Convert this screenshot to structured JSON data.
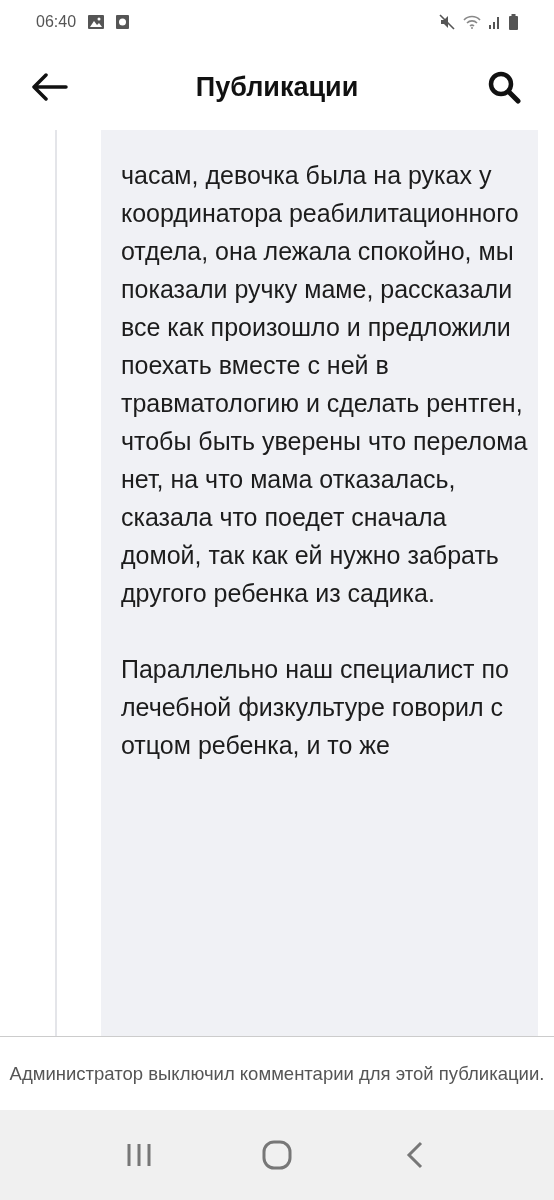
{
  "status_bar": {
    "time": "06:40"
  },
  "header": {
    "title": "Публикации"
  },
  "post": {
    "paragraphs": [
      "часам, девочка была на руках у координатора реабилитационного отдела, она лежала спокойно, мы показали ручку маме, рассказали все как произошло и предложили поехать вместе с ней в травматологию и сделать рентген, чтобы быть уверены что перелома нет, на что мама отказалась, сказала что поедет сначала домой, так как ей нужно забрать другого ребенка из садика.",
      "Параллельно наш специалист по лечебной физкультуре говорил с отцом ребенка, и то же"
    ]
  },
  "footer": {
    "notice": "Администратор выключил комментарии для этой публикации."
  }
}
